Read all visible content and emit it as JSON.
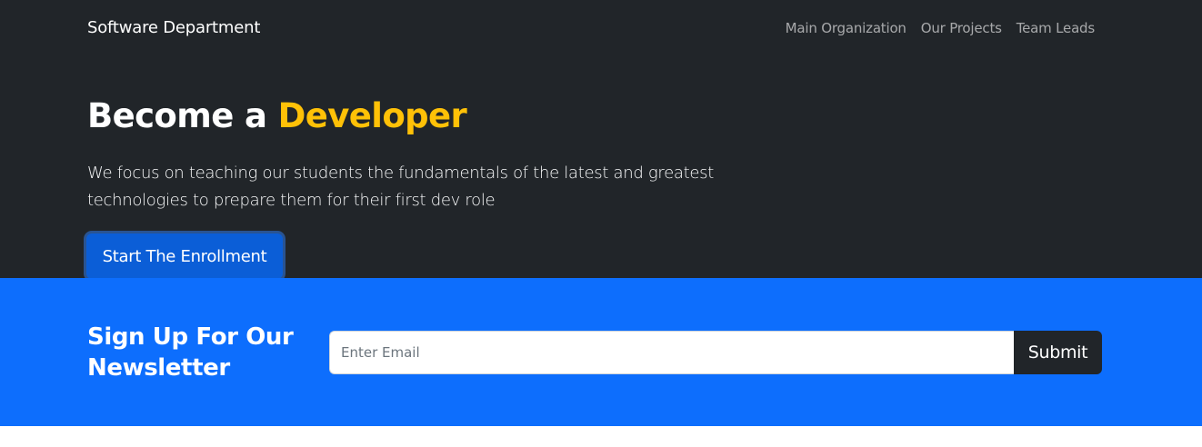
{
  "navbar": {
    "brand": "Software Department",
    "links": [
      "Main Organization",
      "Our Projects",
      "Team Leads"
    ]
  },
  "hero": {
    "title_prefix": "Become a ",
    "title_accent": "Developer",
    "lead": "We focus on teaching our students the fundamentals of the latest and greatest technologies to prepare them for their first dev role",
    "button_label": "Start The Enrollment"
  },
  "newsletter": {
    "title": "Sign Up For Our Newsletter",
    "email_placeholder": "Enter Email",
    "email_value": "",
    "submit_label": "Submit"
  },
  "colors": {
    "dark_bg": "#212529",
    "accent": "#ffc107",
    "primary": "#0d6efd"
  }
}
